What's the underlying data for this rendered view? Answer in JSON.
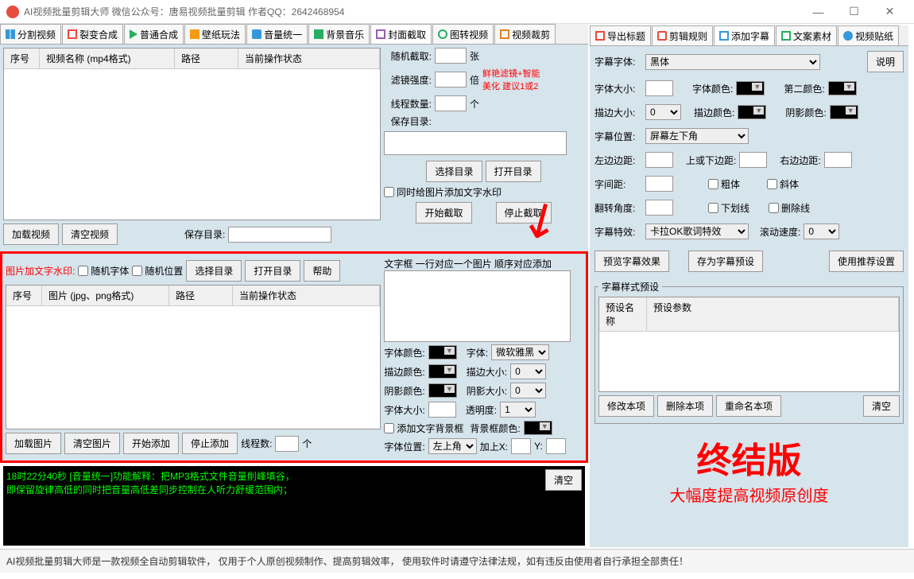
{
  "title": "AI视频批量剪辑大师    微信公众号：唐易视频批量剪辑    作者QQ：2642468954",
  "left_tabs": [
    "分割视频",
    "裂变合成",
    "普通合成",
    "壁纸玩法",
    "音量统一",
    "背景音乐",
    "封面截取",
    "图转视频",
    "视频裁剪"
  ],
  "right_tabs": [
    "导出标题",
    "剪辑规则",
    "添加字幕",
    "文案素材",
    "视频贴纸"
  ],
  "grid1": {
    "cols": [
      "序号",
      "视频名称 (mp4格式)",
      "路径",
      "当前操作状态"
    ]
  },
  "btns1": {
    "load": "加载视频",
    "clear": "清空视频",
    "save_dir_lbl": "保存目录:"
  },
  "cover": {
    "rand_lbl": "随机截取:",
    "rand_unit": "张",
    "filter_lbl": "滤镜强度:",
    "filter_unit": "倍",
    "tip": "鲜艳滤镜+智能\n美化 建议1或2",
    "thread_lbl": "线程数量:",
    "thread_unit": "个",
    "save_lbl": "保存目录:",
    "sel_dir": "选择目录",
    "open_dir": "打开目录",
    "add_wm": "同时给图片添加文字水印",
    "start": "开始截取",
    "stop": "停止截取"
  },
  "wm": {
    "title": "图片加文字水印:",
    "rand_font": "随机字体",
    "rand_pos": "随机位置",
    "sel_dir": "选择目录",
    "open_dir": "打开目录",
    "help": "帮助",
    "grid_cols": [
      "序号",
      "图片 (jpg、png格式)",
      "路径",
      "当前操作状态"
    ],
    "load": "加载图片",
    "clear": "清空图片",
    "start": "开始添加",
    "stop": "停止添加",
    "thread_lbl": "线程数:",
    "thread_unit": "个"
  },
  "textbox": {
    "title": "文字框 一行对应一个图片 顺序对应添加",
    "font_color": "字体颜色:",
    "font": "字体:",
    "font_val": "微软雅黑",
    "stroke_color": "描边颜色:",
    "stroke_size": "描边大小:",
    "stroke_val": "0",
    "shadow_color": "阴影颜色:",
    "shadow_size": "阴影大小:",
    "shadow_val": "0",
    "font_size": "字体大小:",
    "opacity": "透明度:",
    "opacity_val": "1",
    "bg_box": "添加文字背景框",
    "bg_color": "背景框颜色:",
    "pos": "字体位置:",
    "pos_val": "左上角",
    "addx": "加上X:",
    "y": "Y:"
  },
  "sub": {
    "font_lbl": "字幕字体:",
    "font_val": "黑体",
    "explain": "说明",
    "size_lbl": "字体大小:",
    "color_lbl": "字体颜色:",
    "color2_lbl": "第二颜色:",
    "stroke_lbl": "描边大小:",
    "stroke_val": "0",
    "stroke_color": "描边颜色:",
    "shadow_color": "阴影颜色:",
    "pos_lbl": "字幕位置:",
    "pos_val": "屏幕左下角",
    "left_lbl": "左边边距:",
    "top_lbl": "上或下边距:",
    "right_lbl": "右边边距:",
    "spacing_lbl": "字间距:",
    "bold": "粗体",
    "italic": "斜体",
    "rotate_lbl": "翻转角度:",
    "underline": "下划线",
    "strikeout": "删除线",
    "effect_lbl": "字幕特效:",
    "effect_val": "卡拉OK歌词特效",
    "scroll_lbl": "滚动速度:",
    "scroll_val": "0",
    "preview": "预览字幕效果",
    "save_preset": "存为字幕预设",
    "use_rec": "使用推荐设置",
    "preset_title": "字幕样式预设",
    "preset_cols": [
      "预设名称",
      "预设参数"
    ],
    "modify": "修改本项",
    "delete": "删除本项",
    "rename": "重命名本项",
    "clear": "清空"
  },
  "big": {
    "title": "终结版",
    "subtitle": "大幅度提高视频原创度"
  },
  "log": {
    "line1": "18时22分40秒 [音量统一]功能解释：把MP3格式文件音量削峰填谷，",
    "line2": "    即保留旋律高低的同时把音量高低差同步控制在人听力舒缓范围内；",
    "clear": "清空"
  },
  "footer": "AI视频批量剪辑大师是一款视频全自动剪辑软件，  仅用于个人原创视频制作、提高剪辑效率，  使用软件时请遵守法律法规，如有违反由使用者自行承担全部责任！"
}
